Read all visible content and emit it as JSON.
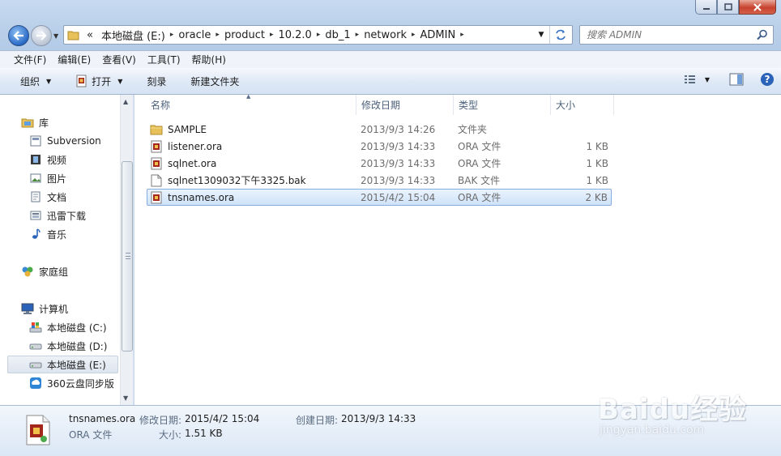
{
  "window": {
    "controls": {
      "minimize_icon": "minimize-icon",
      "maximize_icon": "maximize-icon",
      "close_icon": "close-icon"
    }
  },
  "address_bar": {
    "overflow": "«",
    "crumbs": [
      "本地磁盘 (E:)",
      "oracle",
      "product",
      "10.2.0",
      "db_1",
      "network",
      "ADMIN"
    ]
  },
  "search": {
    "placeholder": "搜索 ADMIN"
  },
  "menu": [
    "文件(F)",
    "编辑(E)",
    "查看(V)",
    "工具(T)",
    "帮助(H)"
  ],
  "toolbar": {
    "organize": "组织",
    "open": "打开",
    "burn": "刻录",
    "new_folder": "新建文件夹"
  },
  "nav": {
    "library": "库",
    "library_items": [
      "Subversion",
      "视频",
      "图片",
      "文档",
      "迅雷下载",
      "音乐"
    ],
    "homegroup": "家庭组",
    "computer": "计算机",
    "computer_items": [
      "本地磁盘 (C:)",
      "本地磁盘 (D:)",
      "本地磁盘 (E:)",
      "360云盘同步版"
    ],
    "selected": "本地磁盘 (E:)"
  },
  "columns": {
    "name": "名称",
    "date": "修改日期",
    "type": "类型",
    "size": "大小"
  },
  "files": [
    {
      "name": "SAMPLE",
      "date": "2013/9/3 14:26",
      "type": "文件夹",
      "size": "",
      "icon": "folder-icon"
    },
    {
      "name": "listener.ora",
      "date": "2013/9/3 14:33",
      "type": "ORA 文件",
      "size": "1 KB",
      "icon": "ora-file-icon"
    },
    {
      "name": "sqlnet.ora",
      "date": "2013/9/3 14:33",
      "type": "ORA 文件",
      "size": "1 KB",
      "icon": "ora-file-icon"
    },
    {
      "name": "sqlnet1309032下午3325.bak",
      "date": "2013/9/3 14:33",
      "type": "BAK 文件",
      "size": "1 KB",
      "icon": "blank-file-icon"
    },
    {
      "name": "tnsnames.ora",
      "date": "2015/4/2 15:04",
      "type": "ORA 文件",
      "size": "2 KB",
      "icon": "ora-file-icon",
      "selected": true
    }
  ],
  "details": {
    "filename": "tnsnames.ora",
    "filetype": "ORA 文件",
    "modified_label": "修改日期:",
    "modified_value": "2015/4/2 15:04",
    "created_label": "创建日期:",
    "created_value": "2013/9/3 14:33",
    "size_label": "大小:",
    "size_value": "1.51 KB"
  },
  "watermark": {
    "brand": "Baidu经验",
    "url": "jingyan.baidu.com"
  },
  "colors": {
    "selection_border": "#84acdd",
    "chrome_blue": "#c7daf0"
  }
}
